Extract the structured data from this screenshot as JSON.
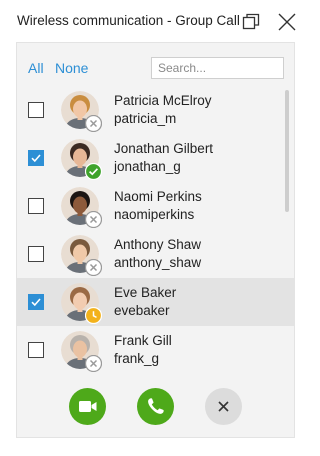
{
  "window": {
    "title": "Wireless communication - Group Call"
  },
  "selection": {
    "all_label": "All",
    "none_label": "None"
  },
  "search": {
    "placeholder": "Search..."
  },
  "contacts": [
    {
      "name": "Patricia McElroy",
      "username": "patricia_m",
      "checked": false,
      "status": "offline",
      "hair": "#c98d3f",
      "skin": "#f1c7a6"
    },
    {
      "name": "Jonathan Gilbert",
      "username": "jonathan_g",
      "checked": true,
      "status": "available",
      "hair": "#3b2a22",
      "skin": "#e7b796"
    },
    {
      "name": "Naomi Perkins",
      "username": "naomiperkins",
      "checked": false,
      "status": "offline",
      "hair": "#1c1512",
      "skin": "#8d5a3b"
    },
    {
      "name": "Anthony Shaw",
      "username": "anthony_shaw",
      "checked": false,
      "status": "offline",
      "hair": "#7a5a3d",
      "skin": "#f0c9a8"
    },
    {
      "name": "Eve Baker",
      "username": "evebaker",
      "checked": true,
      "status": "away",
      "hair": "#9a6a45",
      "skin": "#f2ccb0"
    },
    {
      "name": "Frank Gill",
      "username": "frank_g",
      "checked": false,
      "status": "offline",
      "hair": "#b8b2ac",
      "skin": "#eac2a2"
    }
  ],
  "colors": {
    "accent": "#2d8fd5",
    "call_green": "#4ea91a",
    "status_available": "#3fa32c",
    "status_away": "#f3b21b",
    "status_offline": "#9a9a9a"
  },
  "actions": {
    "video_icon": "video-camera-icon",
    "call_icon": "phone-icon",
    "cancel_icon": "close-icon"
  }
}
